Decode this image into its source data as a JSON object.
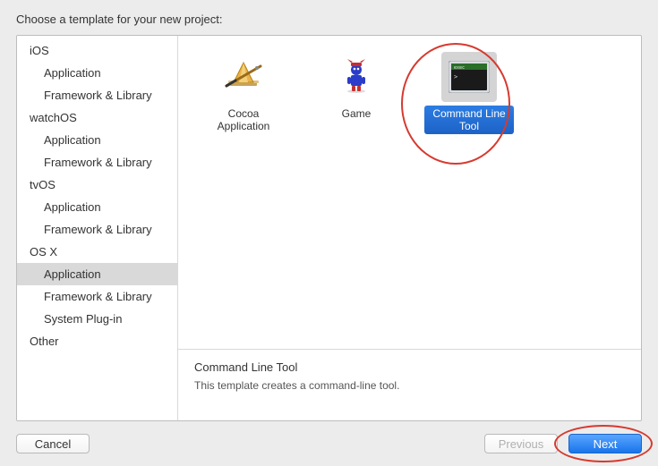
{
  "title": "Choose a template for your new project:",
  "sidebar": [
    {
      "type": "group",
      "label": "iOS"
    },
    {
      "type": "item",
      "label": "Application"
    },
    {
      "type": "item",
      "label": "Framework & Library"
    },
    {
      "type": "group",
      "label": "watchOS"
    },
    {
      "type": "item",
      "label": "Application"
    },
    {
      "type": "item",
      "label": "Framework & Library"
    },
    {
      "type": "group",
      "label": "tvOS"
    },
    {
      "type": "item",
      "label": "Application"
    },
    {
      "type": "item",
      "label": "Framework & Library"
    },
    {
      "type": "group",
      "label": "OS X"
    },
    {
      "type": "item",
      "label": "Application",
      "selected": true
    },
    {
      "type": "item",
      "label": "Framework & Library"
    },
    {
      "type": "item",
      "label": "System Plug-in"
    },
    {
      "type": "group",
      "label": "Other"
    }
  ],
  "templates": [
    {
      "label": "Cocoa Application",
      "icon": "cocoa"
    },
    {
      "label": "Game",
      "icon": "game"
    },
    {
      "label": "Command Line Tool",
      "icon": "cli",
      "selected": true
    }
  ],
  "description": {
    "title": "Command Line Tool",
    "body": "This template creates a command-line tool."
  },
  "buttons": {
    "cancel": "Cancel",
    "previous": "Previous",
    "next": "Next"
  },
  "colors": {
    "selection_blue": "#1e62c7",
    "annotation_red": "#d63a2f"
  }
}
